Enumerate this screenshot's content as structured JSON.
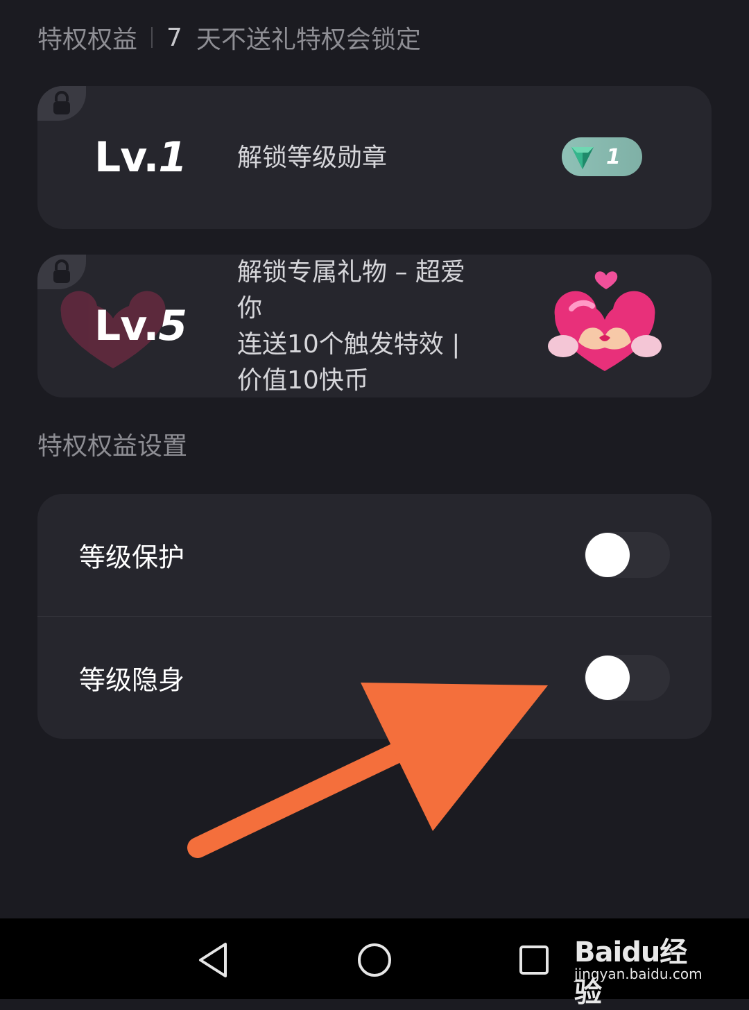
{
  "header": {
    "title": "特权权益",
    "day_count": "7",
    "notice": "天不送礼特权会锁定"
  },
  "privileges": [
    {
      "level_prefix": "Lv.",
      "level_num": "1",
      "description_lines": [
        "解锁等级勋章"
      ],
      "badge_value": "1",
      "locked": true
    },
    {
      "level_prefix": "Lv.",
      "level_num": "5",
      "description_lines": [
        "解锁专属礼物 – 超爱",
        "你",
        "连送10个触发特效 |",
        "价值10快币"
      ],
      "gift_icon": "heart-hands-icon",
      "locked": true
    }
  ],
  "settings": {
    "title": "特权权益设置",
    "rows": [
      {
        "label": "等级保护",
        "enabled": false
      },
      {
        "label": "等级隐身",
        "enabled": false
      }
    ]
  },
  "annotation": {
    "arrow_color": "#f46f3c"
  },
  "colors": {
    "background": "#1b1b21",
    "card": "#26262d",
    "badge": "#8fc1b6"
  },
  "watermark": {
    "brand": "Baidu经验",
    "url": "jingyan.baidu.com"
  }
}
